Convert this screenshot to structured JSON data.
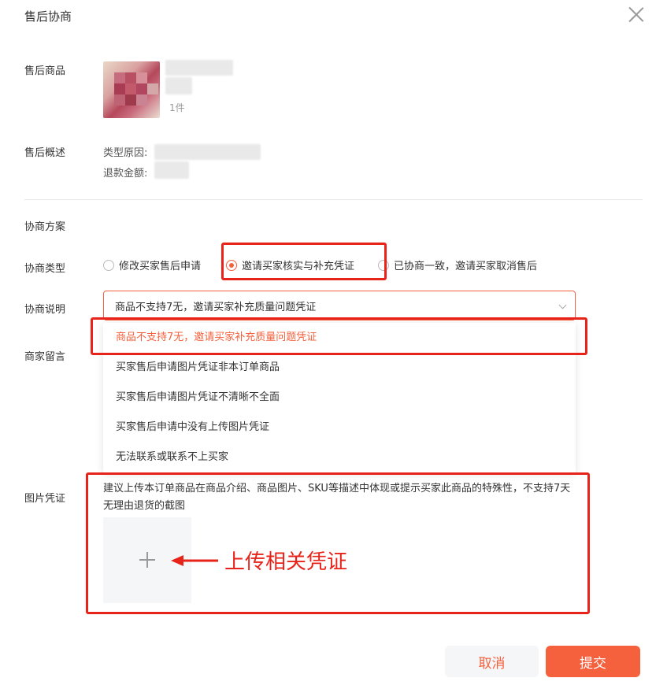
{
  "dialog": {
    "title": "售后协商"
  },
  "product": {
    "label": "售后商品",
    "quantity": "1件"
  },
  "summary": {
    "label": "售后概述",
    "type_reason_label": "类型原因:",
    "refund_amount_label": "退款金额:"
  },
  "plan": {
    "section_label": "协商方案"
  },
  "negotiation_type": {
    "label": "协商类型",
    "options": [
      "修改买家售后申请",
      "邀请买家核实与补充凭证",
      "已协商一致，邀请买家取消售后"
    ],
    "selected_index": 1
  },
  "negotiation_desc": {
    "label": "协商说明",
    "selected": "商品不支持7无，邀请买家补充质量问题凭证",
    "options": [
      "商品不支持7无，邀请买家补充质量问题凭证",
      "买家售后申请图片凭证非本订单商品",
      "买家售后申请图片凭证不清晰不全面",
      "买家售后申请中没有上传图片凭证",
      "无法联系或联系不上买家"
    ]
  },
  "merchant_message": {
    "label": "商家留言"
  },
  "evidence": {
    "label": "图片凭证",
    "hint": "建议上传本订单商品在商品介绍、商品图片、SKU等描述中体现或提示买家此商品的特殊性，不支持7天无理由退货的截图",
    "annotation": "上传相关凭证"
  },
  "footer": {
    "cancel_label": "取消",
    "submit_label": "提交"
  },
  "colors": {
    "accent": "#f5613d",
    "annotation_red": "#e8231a"
  }
}
